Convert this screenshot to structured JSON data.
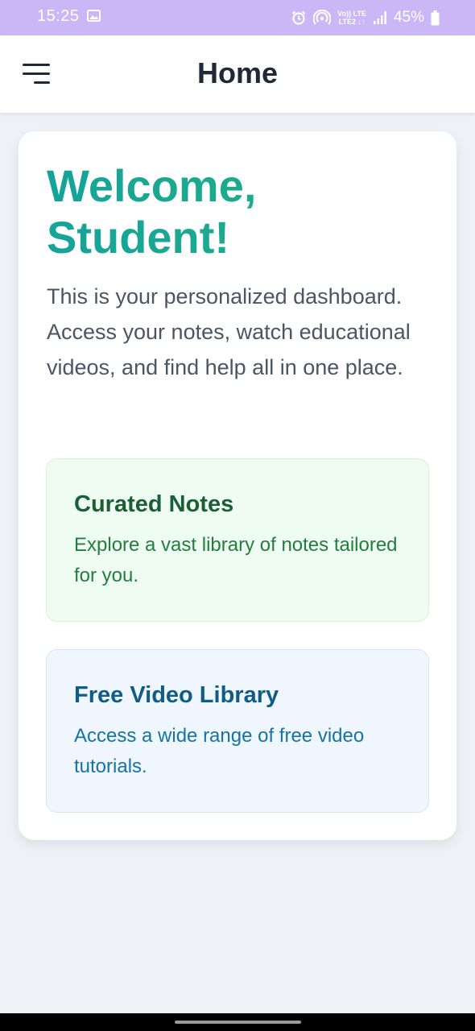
{
  "status_bar": {
    "time": "15:25",
    "network_top": "Vo)) LTE",
    "network_bottom": "LTE2 ↓↑",
    "battery": "45%",
    "icons": [
      "gallery-icon",
      "alarm-icon",
      "hotspot-icon",
      "signal-icon",
      "battery-icon"
    ]
  },
  "header": {
    "title": "Home",
    "menu_icon": "hamburger-menu-icon"
  },
  "main": {
    "welcome_title": "Welcome, Student!",
    "intro": "This is your personalized dashboard. Access your notes, watch educational videos, and find help all in one place.",
    "features": [
      {
        "title": "Curated Notes",
        "description": "Explore a vast library of notes tailored for you."
      },
      {
        "title": "Free Video Library",
        "description": "Access a wide range of free video tutorials."
      }
    ]
  },
  "colors": {
    "status_bar": "#cbb6f6",
    "accent": "#1aa693",
    "notes_title": "#1c5e36",
    "video_title": "#115c86",
    "page_background": "#eef2f7"
  }
}
